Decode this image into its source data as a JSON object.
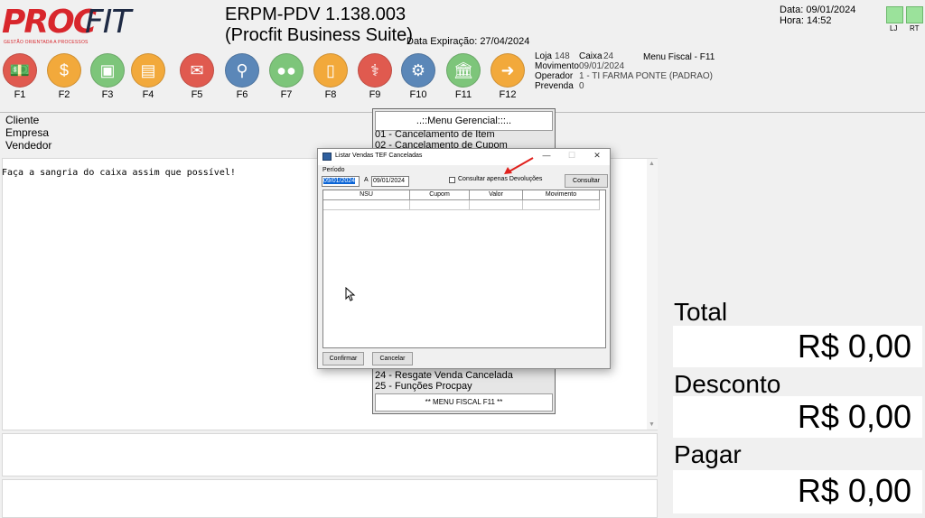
{
  "logo": {
    "proc": "PROC",
    "fit": "FIT",
    "tagline": "GESTÃO ORIENTADA A PROCESSOS"
  },
  "header": {
    "title": "ERPM-PDV 1.138.003",
    "subtitle": "(Procfit Business Suite)",
    "expiry": "Data Expiração: 27/04/2024",
    "date": "Data:  09/01/2024",
    "time": "Hora:  14:52",
    "indicator_lj": "LJ",
    "indicator_rt": "RT",
    "indicator_color": "#9be29b"
  },
  "toolbar": [
    {
      "label": "F1",
      "icon": "money-icon",
      "color": "#e05a4f"
    },
    {
      "label": "F2",
      "icon": "coin-icon",
      "color": "#f2a93b"
    },
    {
      "label": "F3",
      "icon": "card-icon",
      "color": "#7dc57a"
    },
    {
      "label": "F4",
      "icon": "id-card-icon",
      "color": "#f2a93b"
    },
    {
      "label": "F5",
      "icon": "payment-icon",
      "color": "#e05a4f"
    },
    {
      "label": "F6",
      "icon": "search-icon",
      "color": "#5b87b8"
    },
    {
      "label": "F7",
      "icon": "users-icon",
      "color": "#7dc57a"
    },
    {
      "label": "F8",
      "icon": "phone-icon",
      "color": "#f2a93b"
    },
    {
      "label": "F9",
      "icon": "pharmacy-icon",
      "color": "#e05a4f"
    },
    {
      "label": "F10",
      "icon": "settings-icon",
      "color": "#5b87b8"
    },
    {
      "label": "F11",
      "icon": "bank-icon",
      "color": "#7dc57a"
    },
    {
      "label": "F12",
      "icon": "arrow-right-icon",
      "color": "#f2a93b"
    }
  ],
  "store": {
    "loja_label": "Loja",
    "loja": "148",
    "caixa_label": "Caixa",
    "caixa": "24",
    "movimento_label": "Movimento",
    "movimento": "09/01/2024",
    "operador_label": "Operador",
    "operador": "1 - TI FARMA PONTE (PADRAO)",
    "prevenda_label": "Prevenda",
    "prevenda": "0",
    "menu_fiscal": "Menu Fiscal - F11"
  },
  "customer": {
    "cliente": "Cliente",
    "empresa": "Empresa",
    "vendedor": "Vendedor"
  },
  "message": "Faça a sangria do caixa assim que possível!",
  "totals": {
    "total_label": "Total",
    "total_value": "R$ 0,00",
    "desconto_label": "Desconto",
    "desconto_value": "R$ 0,00",
    "pagar_label": "Pagar",
    "pagar_value": "R$ 0,00"
  },
  "menu_gerencial": {
    "title": "..::Menu Gerencial:::..",
    "items_top": [
      "01 - Cancelamento de Item",
      "02 - Cancelamento de Cupom"
    ],
    "items_bottom": [
      "24 - Resgate Venda Cancelada",
      "25 - Funções Procpay"
    ],
    "footer": "** MENU FISCAL F11 **"
  },
  "dialog": {
    "title": "Listar Vendas TEF Canceladas",
    "periodo_label": "Período",
    "date_from": "09/01/2024",
    "date_sep": "A",
    "date_to": "09/01/2024",
    "checkbox_label": "Consultar apenas Devoluções",
    "consultar_button": "Consultar",
    "columns": [
      "NSU",
      "Cupom",
      "Valor",
      "Movimento"
    ],
    "confirmar_button": "Confirmar",
    "cancelar_button": "Cancelar"
  }
}
